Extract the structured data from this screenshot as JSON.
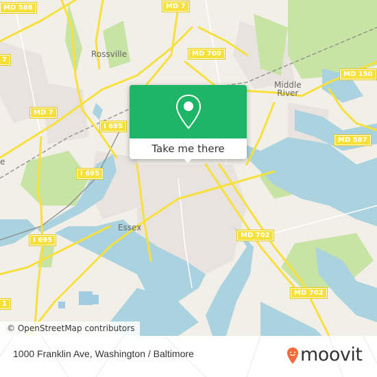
{
  "map": {
    "place_labels": [
      {
        "id": "rossville",
        "text": "Rossville"
      },
      {
        "id": "middle-river",
        "line1": "Middle",
        "line2": "River"
      },
      {
        "id": "essex",
        "text": "Essex"
      },
      {
        "id": "west-edge",
        "text": "e"
      }
    ],
    "road_shields": [
      {
        "id": "md-588",
        "text": "MD 588"
      },
      {
        "id": "md-7-top",
        "text": "MD 7"
      },
      {
        "id": "md-700",
        "text": "MD 700"
      },
      {
        "id": "md-7-right",
        "text": "MD 7"
      },
      {
        "id": "md-150",
        "text": "MD 150"
      },
      {
        "id": "md-7-left",
        "text": "MD 7"
      },
      {
        "id": "i695-top",
        "text": "I 695"
      },
      {
        "id": "i695-mid",
        "text": "I 695"
      },
      {
        "id": "i695-low",
        "text": "I 695"
      },
      {
        "id": "md-587",
        "text": "MD 587"
      },
      {
        "id": "md-702-a",
        "text": "MD 702"
      },
      {
        "id": "md-702-b",
        "text": "MD 702"
      },
      {
        "id": "left-edge-top",
        "text": "7"
      },
      {
        "id": "left-edge-bottom",
        "text": "1"
      }
    ],
    "attribution": "© OpenStreetMap contributors",
    "colors": {
      "land": "#f2efe9",
      "water": "#aad3df",
      "park": "#c8e6a8",
      "road": "#f7e03a",
      "residential": "#e8e0dc"
    }
  },
  "popup": {
    "icon": "map-pin-icon",
    "cta_label": "Take me there",
    "accent": "#1fb566"
  },
  "footer": {
    "address": "1000 Franklin Ave, Washington / Baltimore",
    "brand": "moovit",
    "brand_icon": "moovit-smiley-pin-icon",
    "brand_color": "#f26b3a"
  }
}
